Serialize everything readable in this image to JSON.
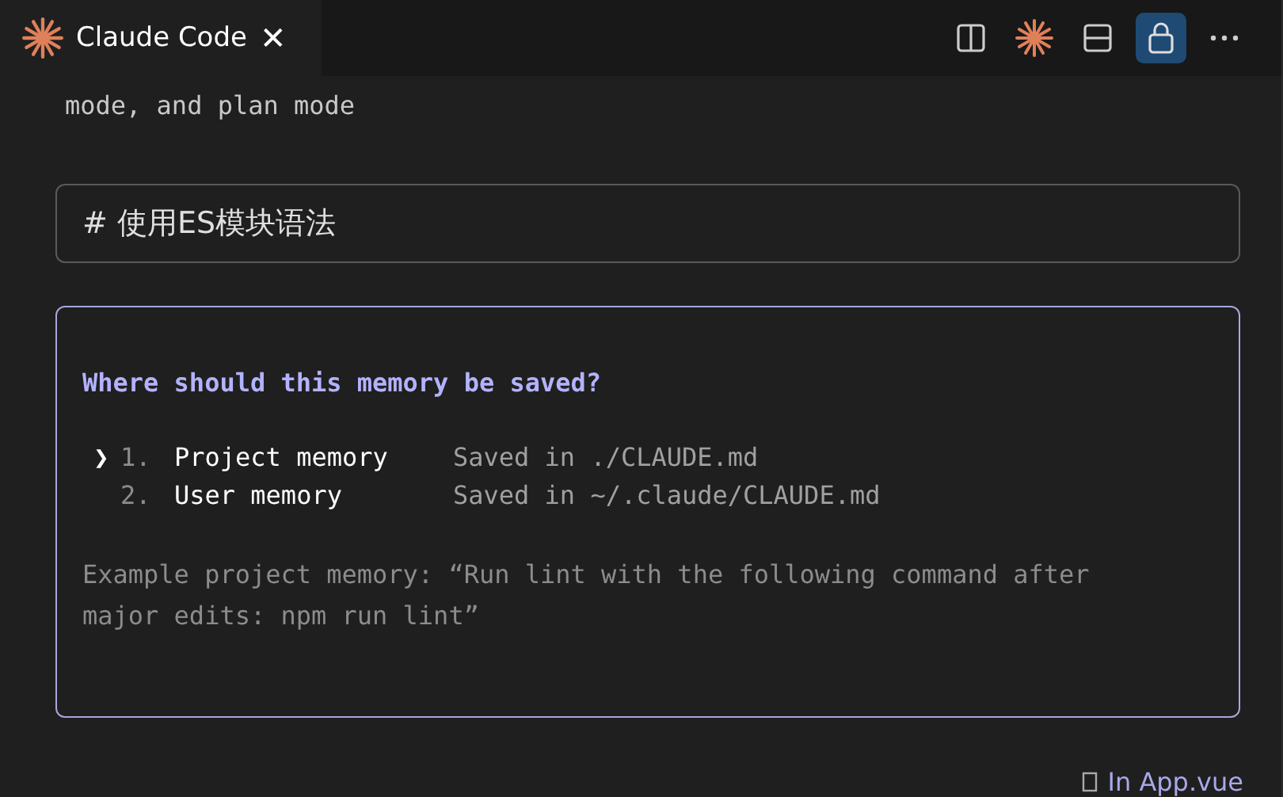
{
  "tab": {
    "title": "Claude Code",
    "close": "✕"
  },
  "toolbar": [
    {
      "kind": "split"
    },
    {
      "kind": "claude"
    },
    {
      "kind": "layout"
    },
    {
      "kind": "lock",
      "selected": true
    },
    {
      "kind": "more"
    }
  ],
  "previous_text": "mode, and plan mode",
  "input": {
    "value": "# 使用ES模块语法"
  },
  "dialog": {
    "question": "Where should this memory be saved?",
    "options": [
      {
        "number": "1.",
        "label": "Project memory",
        "detail": "Saved in ./CLAUDE.md",
        "selected": true
      },
      {
        "number": "2.",
        "label": "User memory",
        "detail": "Saved in ~/.claude/CLAUDE.md",
        "selected": false
      }
    ],
    "pointer": "❯",
    "example": "Example project memory: “Run lint with the following command after major edits: npm run lint”"
  },
  "footer": {
    "context": "In App.vue"
  }
}
